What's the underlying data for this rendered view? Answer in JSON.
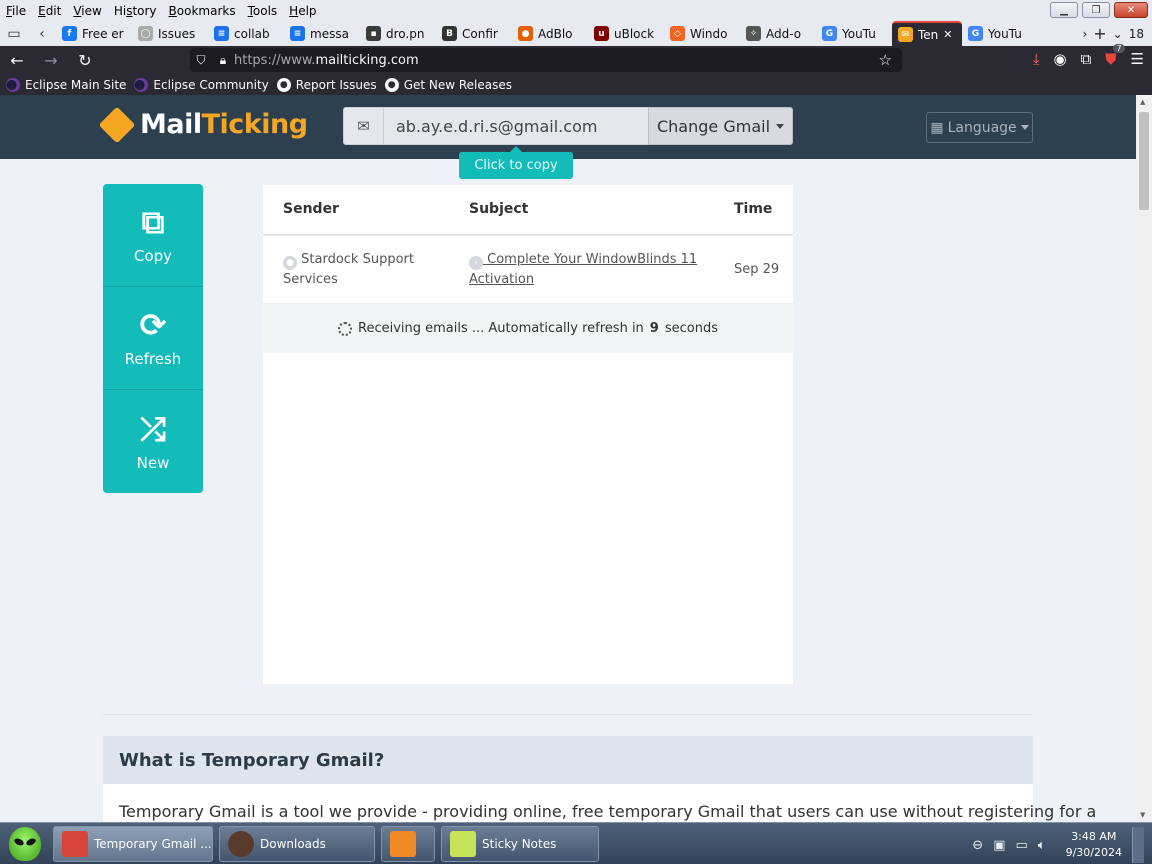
{
  "menubar": {
    "items": [
      "File",
      "Edit",
      "View",
      "History",
      "Bookmarks",
      "Tools",
      "Help"
    ],
    "access_keys": [
      "F",
      "E",
      "V",
      "s",
      "B",
      "T",
      "H"
    ]
  },
  "tabs": [
    {
      "label": "Free er",
      "color": "#1877f2",
      "glyph": "f"
    },
    {
      "label": "Issues",
      "color": "#aaaaaa",
      "glyph": "◯"
    },
    {
      "label": "collab",
      "color": "#1a73e8",
      "glyph": "≡"
    },
    {
      "label": "messa",
      "color": "#1a73e8",
      "glyph": "≡"
    },
    {
      "label": "dro.pn",
      "color": "#3a3a3a",
      "glyph": "▪"
    },
    {
      "label": "Confir",
      "color": "#333333",
      "glyph": "B"
    },
    {
      "label": "AdBlo",
      "color": "#e66000",
      "glyph": "●"
    },
    {
      "label": "uBlock",
      "color": "#800000",
      "glyph": "u"
    },
    {
      "label": "Windo",
      "color": "#f26522",
      "glyph": "◇"
    },
    {
      "label": "Add-o",
      "color": "#555555",
      "glyph": "✧"
    },
    {
      "label": "YouTu",
      "color": "#4285f4",
      "glyph": "G"
    },
    {
      "label": "Ten",
      "color": "#f5a623",
      "glyph": "✉",
      "active": true
    },
    {
      "label": "YouTu",
      "color": "#4285f4",
      "glyph": "G"
    }
  ],
  "tab_count": "18",
  "url": {
    "prefix": "https://www.",
    "domain": "mailticking.com"
  },
  "bookmarks": [
    {
      "label": "Eclipse Main Site",
      "icon": "eclipse-icon"
    },
    {
      "label": "Eclipse Community",
      "icon": "eclipse-icon"
    },
    {
      "label": "Report Issues",
      "icon": "github-icon"
    },
    {
      "label": "Get New Releases",
      "icon": "github-icon"
    }
  ],
  "ublock_badge": "7",
  "site": {
    "logo_mail": "Mail",
    "logo_ticking": "Ticking",
    "email": "ab.ay.e.d.ri.s@gmail.com",
    "change_button": "Change Gmail",
    "language_button": "Language",
    "copy_tooltip": "Click to copy",
    "side_actions": [
      {
        "label": "Copy",
        "icon": "copy-icon",
        "glyph": "⧉"
      },
      {
        "label": "Refresh",
        "icon": "refresh-icon",
        "glyph": "⟳"
      },
      {
        "label": "New",
        "icon": "shuffle-icon",
        "glyph": "⤮"
      }
    ],
    "inbox": {
      "headers": {
        "sender": "Sender",
        "subject": "Subject",
        "time": "Time"
      },
      "rows": [
        {
          "sender": "Stardock Support Services",
          "subject": "Complete Your WindowBlinds 11 Activation",
          "time": "Sep 29"
        }
      ],
      "status_prefix": "Receiving emails ... Automatically refresh in ",
      "status_seconds": "9",
      "status_suffix": " seconds"
    },
    "what_title": "What is Temporary Gmail?",
    "what_text": "Temporary Gmail is a tool we provide - providing online, free temporary Gmail that users can use without registering for a"
  },
  "taskbar": {
    "items": [
      {
        "label": "Temporary Gmail ...",
        "active": true,
        "color": "#d9443a"
      },
      {
        "label": "Downloads",
        "active": false,
        "color": "#5a3a2a"
      },
      {
        "label": "",
        "active": false,
        "color": "#f08a24"
      },
      {
        "label": "Sticky Notes",
        "active": false,
        "color": "#c6e35a"
      }
    ],
    "time": "3:48 AM",
    "date": "9/30/2024"
  }
}
